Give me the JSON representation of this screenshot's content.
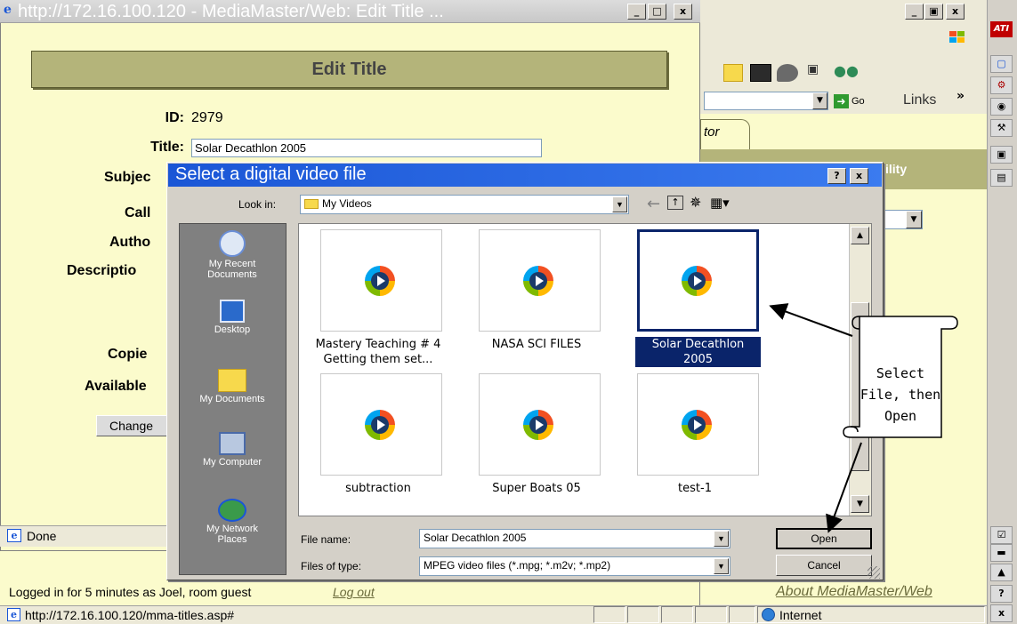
{
  "window": {
    "title": "http://172.16.100.120 - MediaMaster/Web: Edit Title ...",
    "min": "_",
    "max": "□",
    "close": "x"
  },
  "form": {
    "heading": "Edit Title",
    "id_label": "ID:",
    "id_value": "2979",
    "title_label": "Title:",
    "title_value": "Solar Decathlon 2005",
    "subject_label": "Subjec",
    "call_label": "Call",
    "author_label": "Autho",
    "description_label": "Descriptio",
    "copies_label": "Copie",
    "available_label": "Available",
    "change_button": "Change"
  },
  "popup_status": "Done",
  "bg_browser": {
    "go_label": "Go",
    "links_label": "Links",
    "links_chevron": "»",
    "tab_fragment": "tor",
    "ility_fragment": "ility",
    "logged_in_text": "Logged in for 5 minutes as Joel, room guest",
    "logout_link": "Log out",
    "about_link": "About MediaMaster/Web"
  },
  "dialog": {
    "title": "Select a digital video file",
    "help_button": "?",
    "close_button": "x",
    "look_in_label": "Look in:",
    "look_in_value": "My Videos",
    "places": [
      {
        "label": "My Recent Documents",
        "icon": "recent-documents-icon"
      },
      {
        "label": "Desktop",
        "icon": "desktop-icon"
      },
      {
        "label": "My Documents",
        "icon": "my-documents-icon"
      },
      {
        "label": "My Computer",
        "icon": "my-computer-icon"
      },
      {
        "label": "My Network Places",
        "icon": "network-places-icon"
      }
    ],
    "files": [
      {
        "name": "Mastery Teaching # 4 Getting them set...",
        "icon": "media-player-icon"
      },
      {
        "name": "NASA SCI FILES",
        "icon": "media-player-icon"
      },
      {
        "name": "Solar Decathlon 2005",
        "icon": "media-player-icon",
        "selected": true
      },
      {
        "name": "subtraction",
        "icon": "media-player-icon"
      },
      {
        "name": "Super Boats 05",
        "icon": "media-player-icon"
      },
      {
        "name": "test-1",
        "icon": "media-player-icon"
      }
    ],
    "file_name_label": "File name:",
    "file_name_value": "Solar Decathlon 2005",
    "file_type_label": "Files of type:",
    "file_type_value": "MPEG video files (*.mpg; *.m2v; *.mp2)",
    "open_button": "Open",
    "cancel_button": "Cancel"
  },
  "callout": {
    "text": "Select File, then Open"
  },
  "statusbar": {
    "url": "http://172.16.100.120/mma-titles.asp#",
    "zone": "Internet"
  },
  "colors": {
    "page_bg": "#fbfbcc",
    "heading_bar": "#b4b47a",
    "xp_title_blue": "#0a246a",
    "dialog_title_blue": "#1a56d6",
    "selected_blue": "#0a246a",
    "places_bg": "#808080"
  }
}
